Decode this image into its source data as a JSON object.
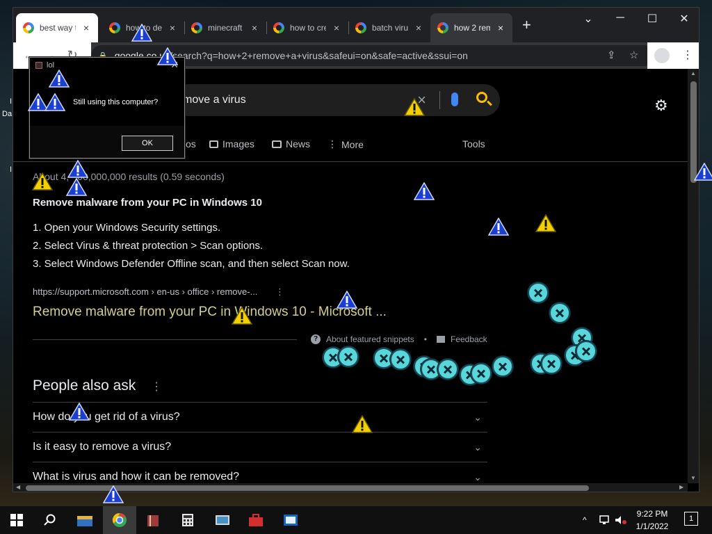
{
  "desktop": {
    "labels": [
      "Da",
      "I",
      "I"
    ]
  },
  "browser": {
    "tabs": [
      {
        "title": "best way t",
        "icon": "google-icon"
      },
      {
        "title": "how to de",
        "icon": "google-icon"
      },
      {
        "title": "minecraft",
        "icon": "google-icon"
      },
      {
        "title": "how to cre",
        "icon": "google-icon"
      },
      {
        "title": "batch viru",
        "icon": "google-icon"
      },
      {
        "title": "how 2 rem",
        "icon": "google-icon"
      }
    ],
    "tab_close_glyph": "×",
    "new_tab_glyph": "+",
    "window_controls": {
      "chevron": "⌄",
      "minimize": "─",
      "maximize": "☐",
      "close": "✕"
    },
    "nav": {
      "back": "←",
      "forward": "→",
      "reload": "↻"
    },
    "address": {
      "host": "google.co.uk",
      "path": "/search?q=how+2+remove+a+virus&safeui=on&safe=active&ssui=on"
    },
    "address_actions": {
      "share": "⇪",
      "bookmark": "☆",
      "menu": "⋮"
    }
  },
  "search": {
    "query": "move a virus",
    "clear_glyph": "×",
    "tabs": [
      {
        "label": "os",
        "icon": ""
      },
      {
        "label": "Images",
        "icon": "image-icon"
      },
      {
        "label": "News",
        "icon": "news-icon"
      },
      {
        "label": "More",
        "icon": "more-vert-icon"
      }
    ],
    "tools_label": "Tools",
    "settings_glyph": "⚙"
  },
  "results": {
    "stats": "About 4,",
    "stats_tail": "00,000,000 results (0.59 seconds)",
    "featured_title": "Remove malware from your PC in Windows 10",
    "featured_steps": [
      "1.  Open your Windows Security settings.",
      "2.  Select Virus & threat protection > Scan options.",
      "3.  Select Windows Defender Offline scan, and then select Scan now."
    ],
    "cite": "https://support.microsoft.com › en-us › office › remove-...",
    "cite_menu": "⋮",
    "link_title": "Remove malware from your PC in Windows 10 - Microsoft ...",
    "about_snippets": "About featured snippets",
    "bullet": "•",
    "feedback": "Feedback"
  },
  "people_also_ask": {
    "title": "People also ask",
    "menu": "⋮",
    "chevron": "⌄",
    "questions": [
      "How do you get rid of a virus?",
      "Is it easy to remove a virus?",
      "What is virus and how it can be removed?"
    ]
  },
  "dialog": {
    "title": "lol",
    "message": "Still using this computer?",
    "ok_label": "OK",
    "close_glyph": "✕"
  },
  "taskbar": {
    "apps": [
      "start-icon",
      "search-icon",
      "file-explorer-icon",
      "chrome-icon",
      "books-icon",
      "calculator-icon",
      "control-panel-icon",
      "toolbox-icon",
      "news-app-icon"
    ],
    "tray": {
      "chevron": "^",
      "network": "network-icon",
      "volume": "volume-muted-icon"
    },
    "time": "9:22 PM",
    "date": "1/1/2022",
    "notifications": "1"
  },
  "colors": {
    "accent_blue": "#1a3fd1",
    "warning_yellow": "#f5d000",
    "error_cyan": "#58d6d9",
    "link_yellow": "#d2cf8a"
  }
}
